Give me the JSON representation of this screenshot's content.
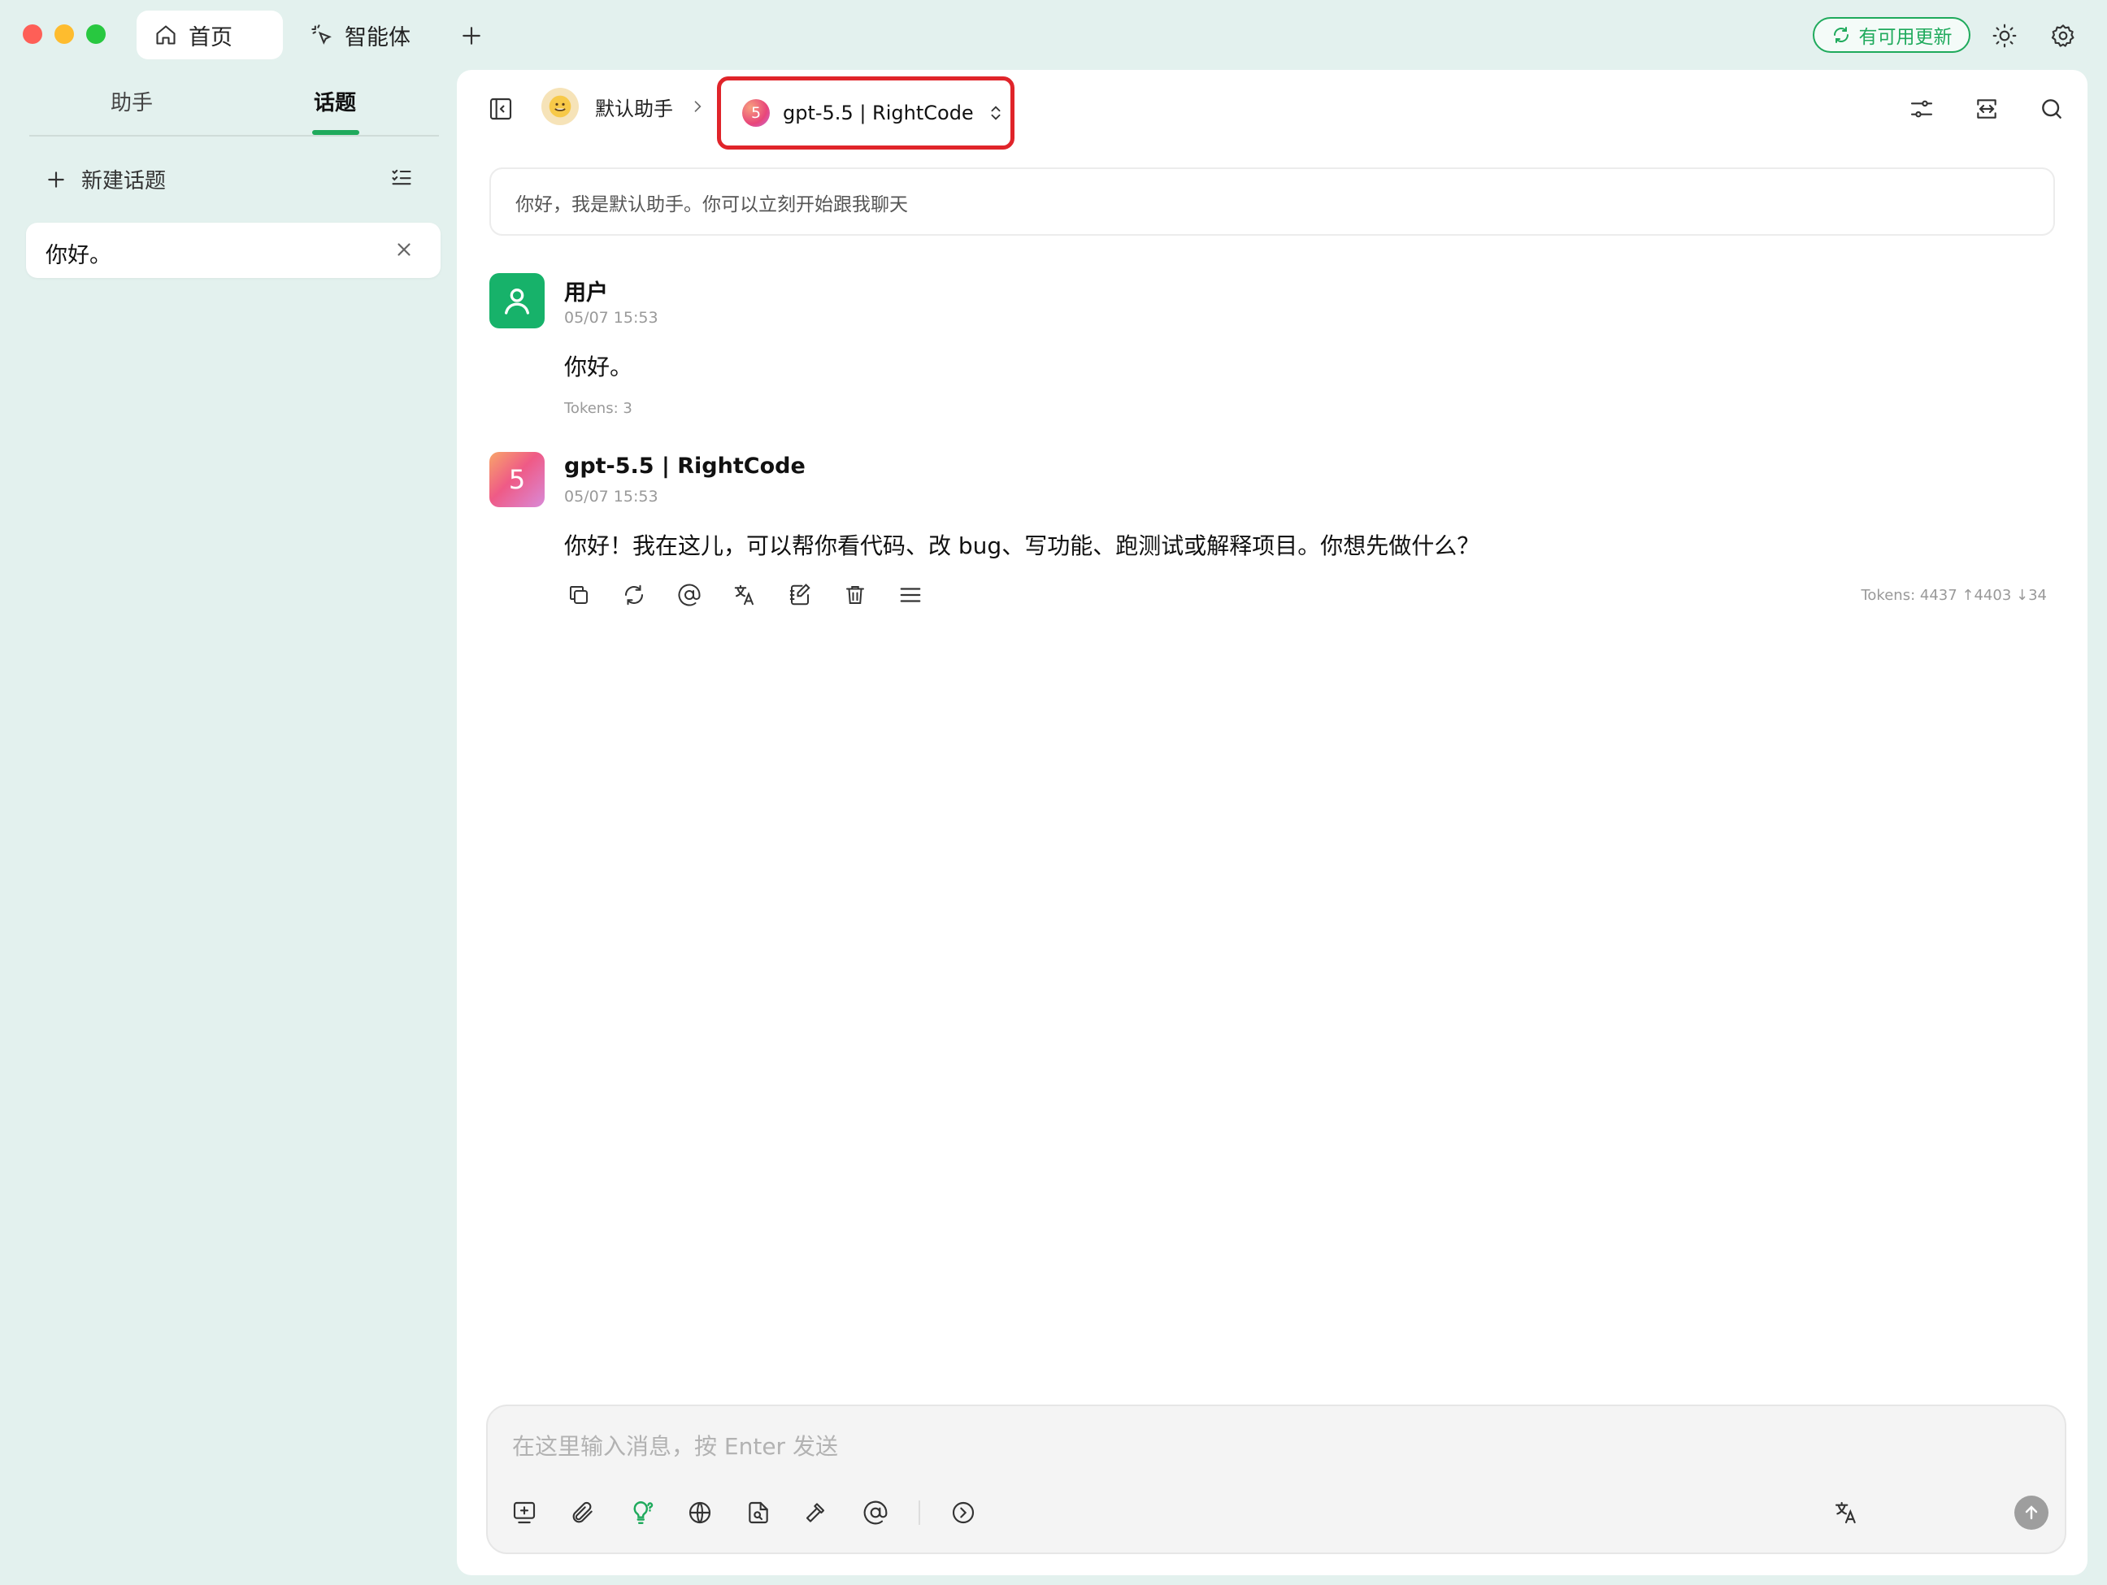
{
  "titlebar": {
    "tabs": [
      {
        "label": "首页",
        "icon": "home-icon",
        "active": true
      },
      {
        "label": "智能体",
        "icon": "sparkle-cursor-icon",
        "active": false
      }
    ],
    "update_label": "有可用更新"
  },
  "sidebar": {
    "tabs": [
      {
        "label": "助手",
        "active": false
      },
      {
        "label": "话题",
        "active": true
      }
    ],
    "new_topic_label": "新建话题",
    "topics": [
      {
        "label": "你好。"
      }
    ]
  },
  "header": {
    "assistant_name": "默认助手",
    "model_name": "gpt-5.5 | RightCode",
    "model_badge": "5"
  },
  "welcome_text": "你好，我是默认助手。你可以立刻开始跟我聊天",
  "messages": [
    {
      "role": "user",
      "name": "用户",
      "time": "05/07 15:53",
      "content": "你好。",
      "tokens": "Tokens: 3"
    },
    {
      "role": "assistant",
      "name": "gpt-5.5 | RightCode",
      "avatar_text": "5",
      "time": "05/07 15:53",
      "content": "你好！我在这儿，可以帮你看代码、改 bug、写功能、跑测试或解释项目。你想先做什么？",
      "tokens": "Tokens: 4437 ↑4403 ↓34"
    }
  ],
  "composer": {
    "placeholder": "在这里输入消息，按 Enter 发送",
    "value": ""
  },
  "colors": {
    "accent": "#1faa5c",
    "highlight_box": "#e0242a",
    "window_bg": "#e3f1ee"
  }
}
